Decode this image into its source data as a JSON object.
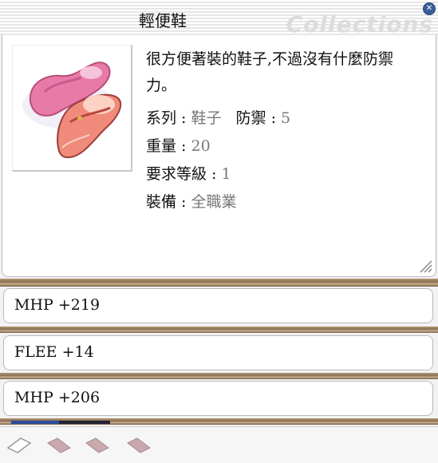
{
  "window": {
    "title": "輕便鞋",
    "watermark": "Collections"
  },
  "item": {
    "description": "很方便著裝的鞋子,不過沒有什麼防禦力。",
    "series_label": "系列 : ",
    "series_value": "鞋子",
    "defense_label": "防禦 : ",
    "defense_value": "5",
    "weight_label": "重量 : ",
    "weight_value": "20",
    "level_label": "要求等級 : ",
    "level_value": "1",
    "equip_label": "裝備 : ",
    "equip_value": "全職業"
  },
  "options": [
    "MHP +219",
    "FLEE +14",
    "MHP +206"
  ],
  "slots": {
    "count": 4,
    "empty_color": "#ffffff",
    "filled_color": "#c9a9ae"
  },
  "colors": {
    "close_button": "#3a5d9c",
    "value_text": "#777777",
    "shoe_pink": "#e87aa8",
    "shoe_coral": "#f08a7a"
  }
}
